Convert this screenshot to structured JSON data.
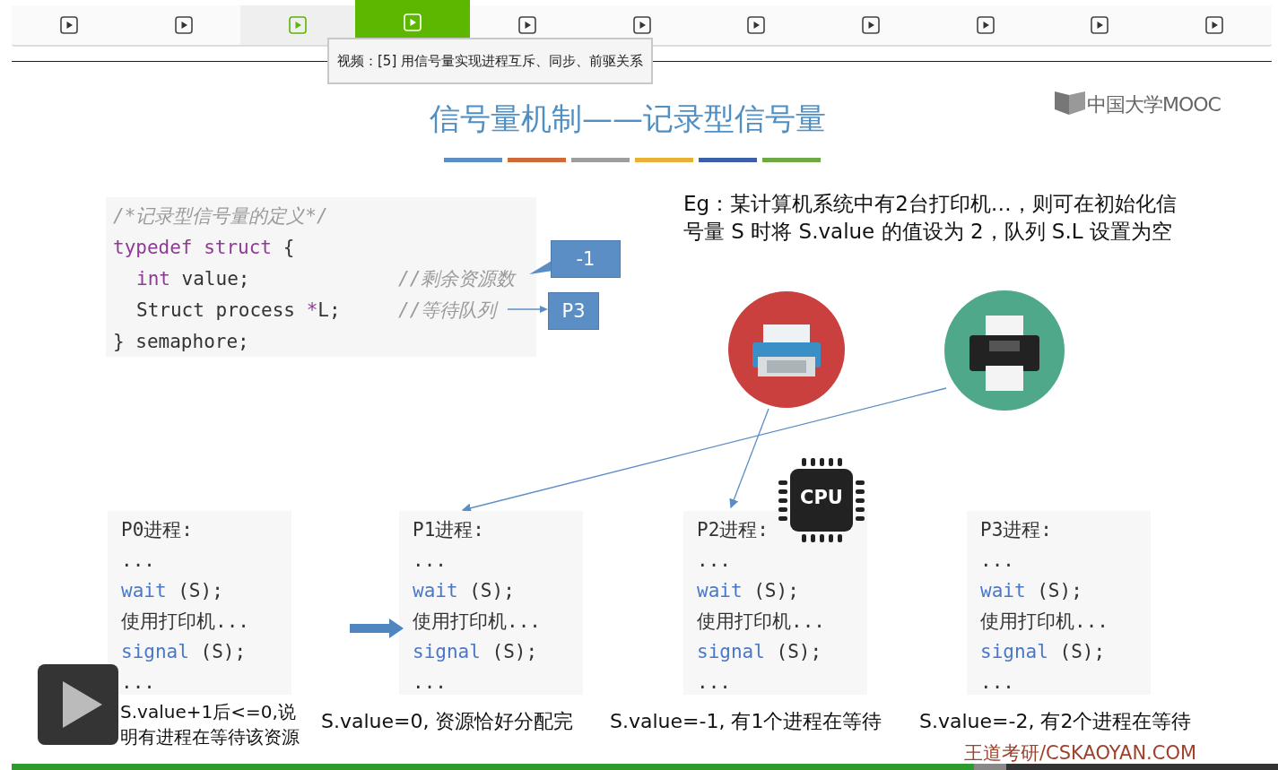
{
  "tabs": [
    {
      "selected": false,
      "visited": false
    },
    {
      "selected": false,
      "visited": false
    },
    {
      "selected": false,
      "visited": true
    },
    {
      "selected": true,
      "visited": false
    },
    {
      "selected": false,
      "visited": false
    },
    {
      "selected": false,
      "visited": false
    },
    {
      "selected": false,
      "visited": false
    },
    {
      "selected": false,
      "visited": false
    },
    {
      "selected": false,
      "visited": false
    },
    {
      "selected": false,
      "visited": false
    },
    {
      "selected": false,
      "visited": false
    }
  ],
  "tooltip": {
    "text": "视频：[5] 用信号量实现进程互斥、同步、前驱关系"
  },
  "slide": {
    "logo": "中国大学MOOC",
    "title": "信号量机制——记录型信号量",
    "title_rule": [
      {
        "color": "#5b8ec4"
      },
      {
        "color": "#d0693a"
      },
      {
        "color": "#9e9e9e"
      },
      {
        "color": "#e8b034"
      },
      {
        "color": "#3d5ea8"
      },
      {
        "color": "#6ea944"
      }
    ],
    "code": [
      {
        "indented": false,
        "parts": [
          {
            "kind": "comment",
            "text": "/*记录型信号量的定义*/"
          }
        ]
      },
      {
        "indented": false,
        "parts": [
          {
            "kind": "keyword",
            "text": "typedef"
          },
          {
            "kind": "keyword",
            "text": " struct"
          },
          {
            "kind": "plain",
            "text": " {"
          }
        ]
      },
      {
        "indented": true,
        "parts": [
          {
            "kind": "keyword",
            "text": "int"
          },
          {
            "kind": "plain",
            "text": " value;"
          }
        ],
        "comment": "//剩余资源数"
      },
      {
        "indented": true,
        "parts": [
          {
            "kind": "plain",
            "text": "Struct process "
          },
          {
            "kind": "keyword",
            "text": "*"
          },
          {
            "kind": "plain",
            "text": "L;"
          }
        ],
        "comment": "//等待队列"
      },
      {
        "indented": false,
        "parts": [
          {
            "kind": "plain",
            "text": "} semaphore;"
          }
        ]
      }
    ],
    "callouts": [
      {
        "kind": "speech",
        "text": "-1"
      },
      {
        "kind": "arrow",
        "text": "P3"
      }
    ],
    "example": "Eg：某计算机系统中有2台打印机…，则可在初始化信号量 S 时将 S.value 的值设为 2，队列 S.L 设置为空",
    "processes": [
      {
        "title": "P0进程:",
        "pointer": false,
        "lines": [
          {
            "text": "..."
          },
          {
            "keyword": "wait",
            "text": " (S);"
          },
          {
            "text": "使用打印机..."
          },
          {
            "keyword": "signal",
            "text": " (S);"
          },
          {
            "text": "..."
          }
        ],
        "caption": "S.value+1后<=0,说明有进程在等待该资源"
      },
      {
        "title": "P1进程:",
        "pointer": true,
        "lines": [
          {
            "text": "..."
          },
          {
            "keyword": "wait",
            "text": " (S);"
          },
          {
            "text": "使用打印机..."
          },
          {
            "keyword": "signal",
            "text": " (S);"
          },
          {
            "text": "..."
          }
        ],
        "caption": "S.value=0, 资源恰好分配完"
      },
      {
        "title": "P2进程:",
        "pointer": false,
        "lines": [
          {
            "text": "..."
          },
          {
            "keyword": "wait",
            "text": " (S);"
          },
          {
            "text": "使用打印机..."
          },
          {
            "keyword": "signal",
            "text": " (S);"
          },
          {
            "text": "..."
          }
        ],
        "caption": "S.value=-1, 有1个进程在等待"
      },
      {
        "title": "P3进程:",
        "pointer": false,
        "lines": [
          {
            "text": "..."
          },
          {
            "keyword": "wait",
            "text": " (S);"
          },
          {
            "text": "使用打印机..."
          },
          {
            "keyword": "signal",
            "text": " (S);"
          },
          {
            "text": "..."
          }
        ],
        "caption": "S.value=-2, 有2个进程在等待"
      }
    ],
    "cpu_label": "CPU",
    "watermark": "王道考研/CSKAOYAN.COM"
  },
  "player": {
    "paused": true,
    "progress": {
      "level": 0.76
    }
  }
}
